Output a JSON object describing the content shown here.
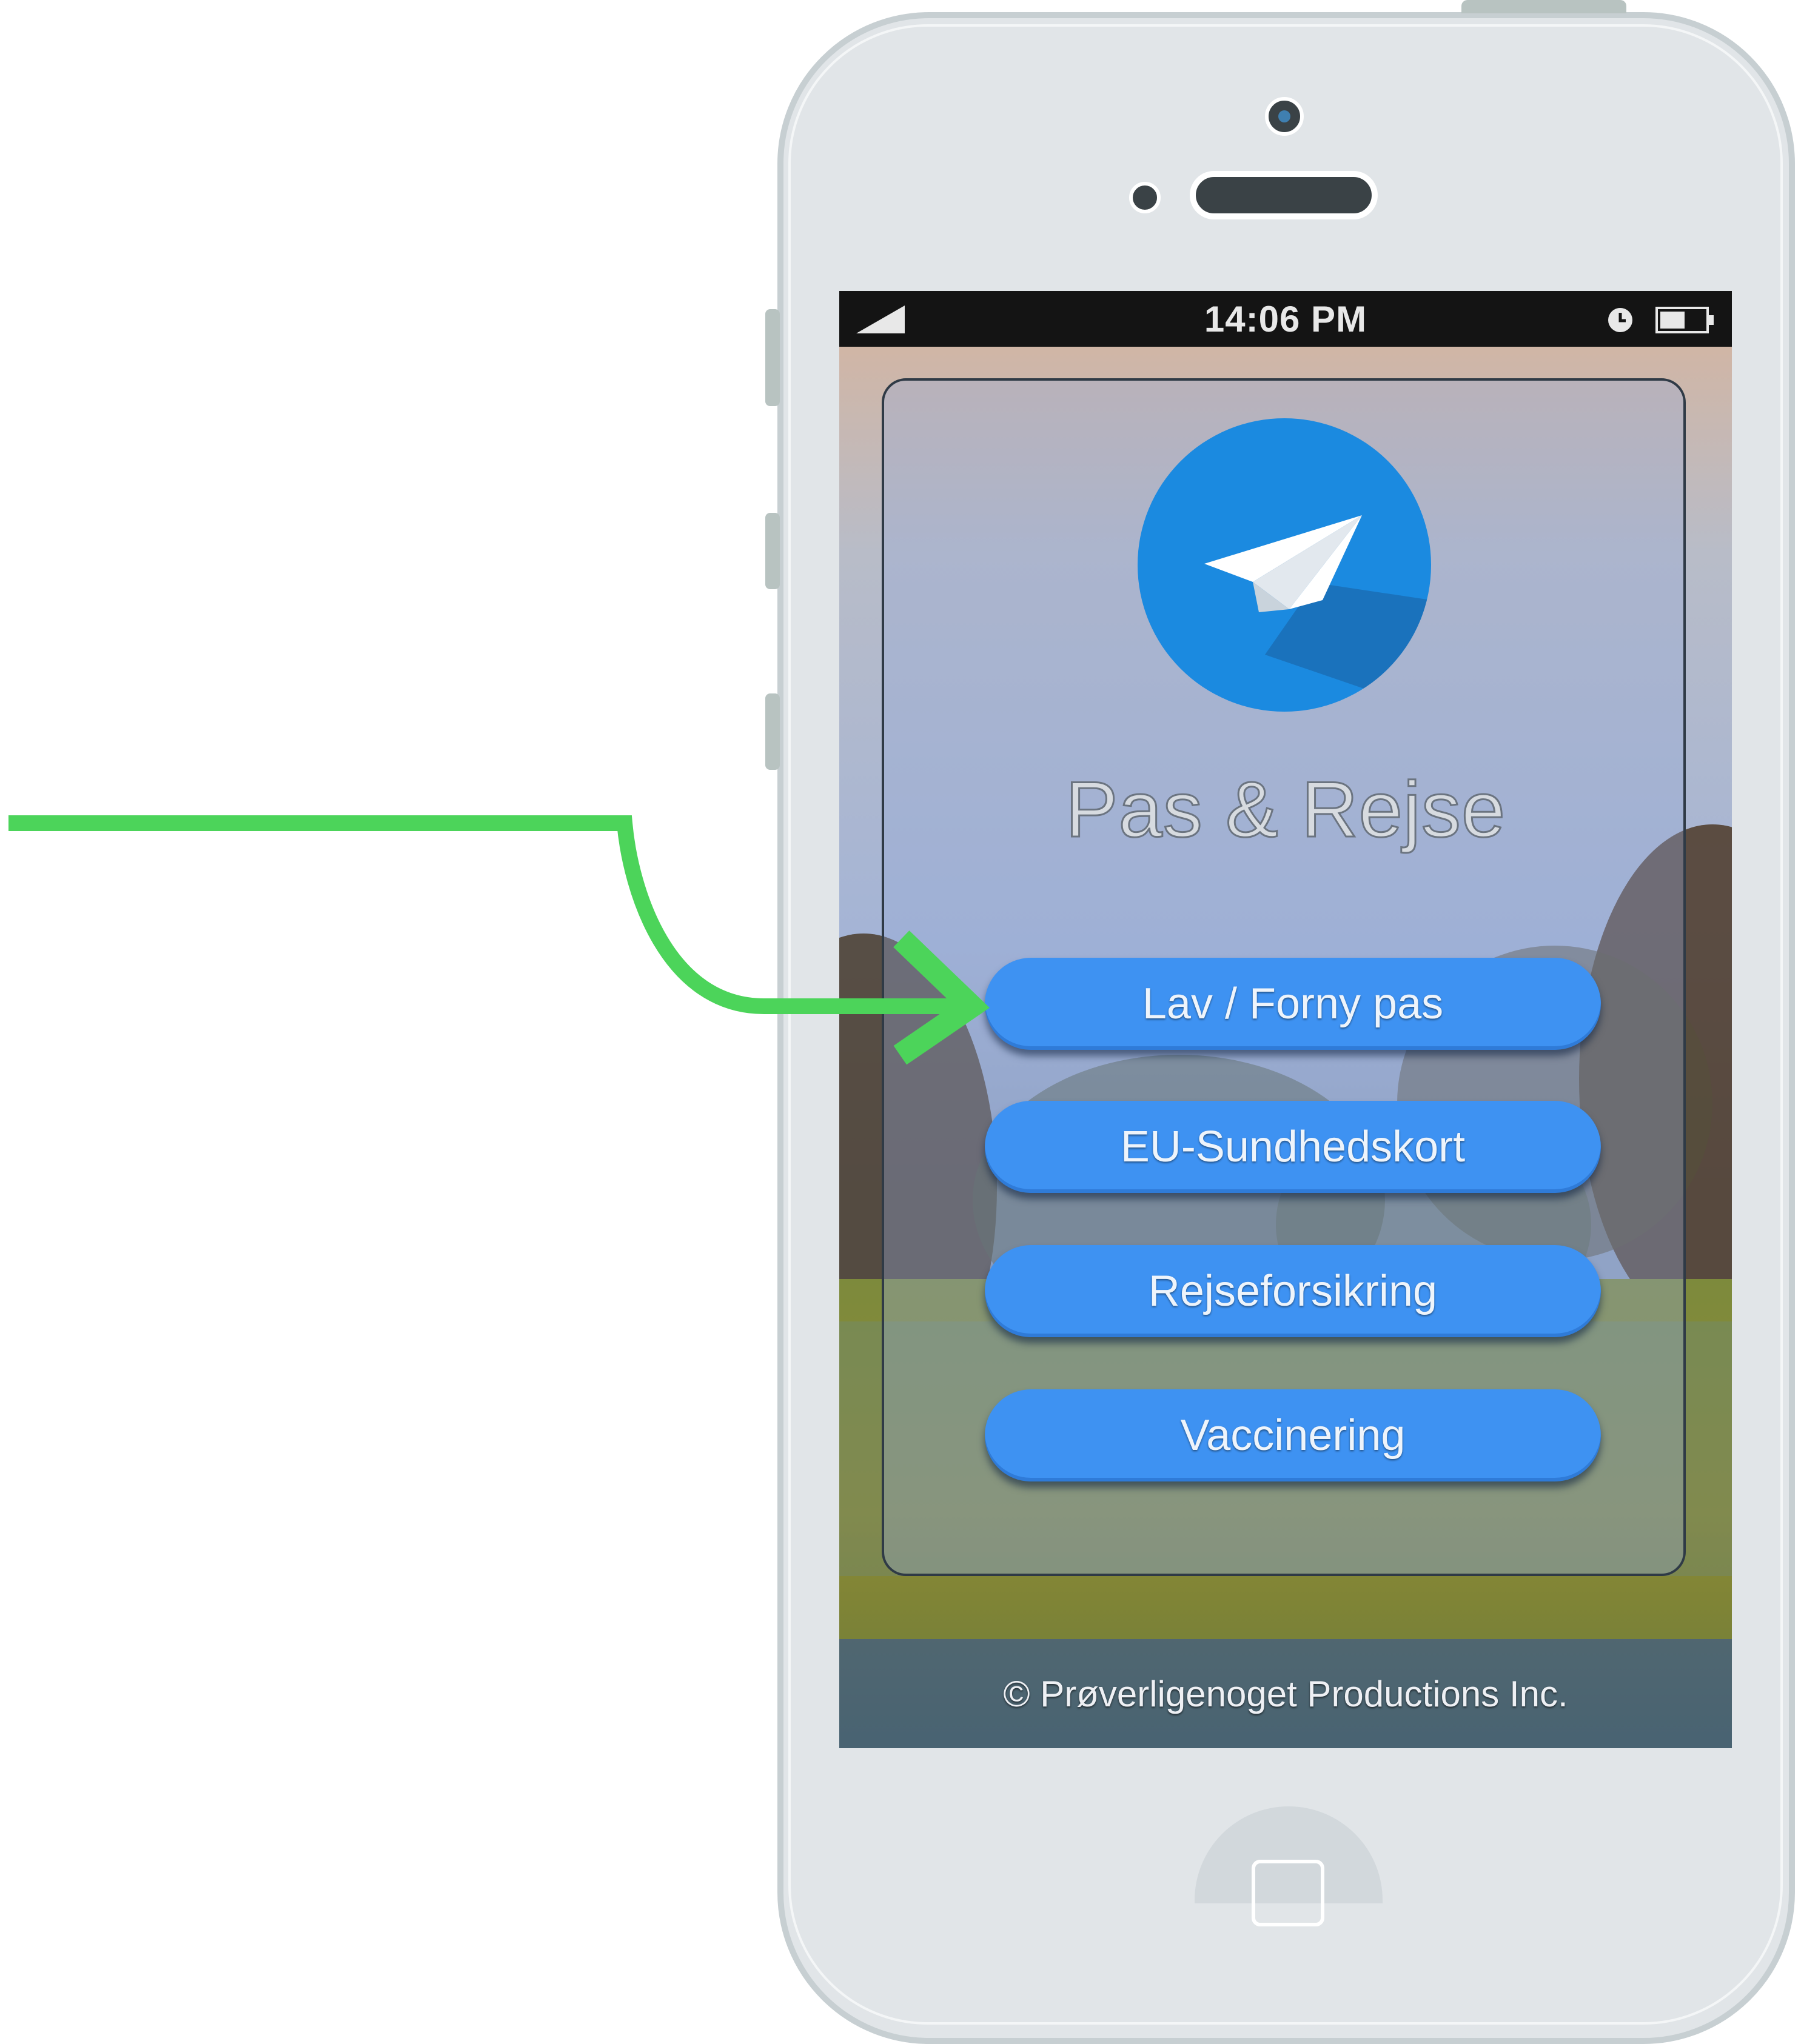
{
  "status_bar": {
    "time": "14:06 PM"
  },
  "app": {
    "title": "Pas & Rejse",
    "logo_icon": "paper-plane-icon",
    "menu": [
      {
        "label": "Lav / Forny pas"
      },
      {
        "label": "EU-Sundhedskort"
      },
      {
        "label": "Rejseforsikring"
      },
      {
        "label": "Vaccinering"
      }
    ],
    "footer": "© Prøverligenoget Productions Inc."
  },
  "annotation": {
    "arrow_color": "#4cd45a",
    "points_to": "Lav / Forny pas"
  },
  "colors": {
    "button": "#3e92f2",
    "logo": "#1b8ae0",
    "status_bar": "#141414",
    "phone_body": "#e1e5e8"
  }
}
